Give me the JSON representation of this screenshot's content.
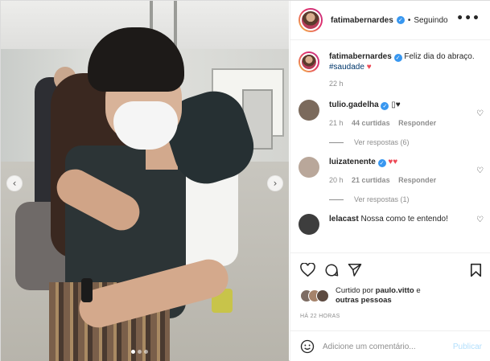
{
  "header": {
    "username": "fatimabernardes",
    "separator": "•",
    "follow_status": "Seguindo",
    "more": "•••"
  },
  "caption": {
    "username": "fatimabernardes",
    "text": "Feliz dia do abraço.",
    "hashtag": "#saudade",
    "heart": "♥",
    "time": "22 h"
  },
  "comments": [
    {
      "username": "tulio.gadelha",
      "text": "▯♥",
      "time": "21 h",
      "likes": "44 curtidas",
      "reply": "Responder",
      "view_replies": "Ver respostas (6)",
      "avatar_color": "#7b6a5c"
    },
    {
      "username": "luizatenente",
      "text": "♥♥",
      "time": "20 h",
      "likes": "21 curtidas",
      "reply": "Responder",
      "view_replies": "Ver respostas (1)",
      "avatar_color": "#b9a79a"
    },
    {
      "username": "lelacast",
      "text": "Nossa como te entendo!",
      "avatar_color": "#3d3d3d"
    }
  ],
  "likes": {
    "prefix": "Curtido por",
    "user": "paulo.vitto",
    "suffix": "e",
    "others": "outras pessoas"
  },
  "post_time": "HÁ 22 HORAS",
  "comment_input": {
    "placeholder": "Adicione um comentário...",
    "publish_label": "Publicar"
  },
  "nav": {
    "prev": "‹",
    "next": "›"
  },
  "verified_mark": "✓",
  "colors": {
    "link": "#00376b",
    "like_red": "#ed4956",
    "verified": "#3897f0",
    "muted": "#8e8e8e",
    "publish_disabled": "#b2dffc"
  }
}
